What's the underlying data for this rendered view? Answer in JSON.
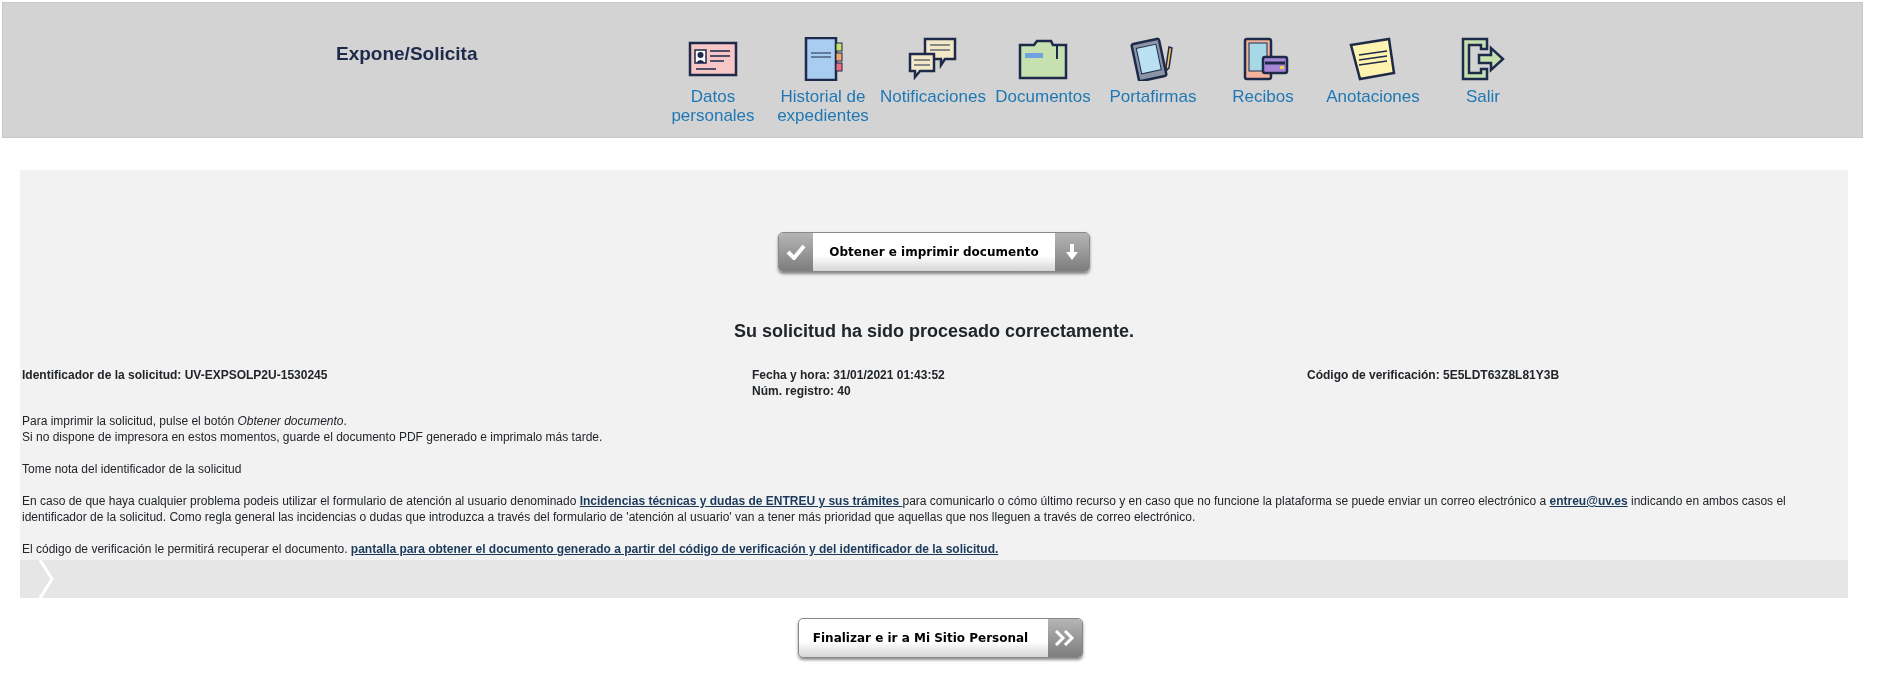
{
  "header": {
    "title": "Expone/Solicita",
    "nav": [
      {
        "label": "Datos personales"
      },
      {
        "label": "Historial de expedientes"
      },
      {
        "label": "Notificaciones"
      },
      {
        "label": "Documentos"
      },
      {
        "label": "Portafirmas"
      },
      {
        "label": "Recibos"
      },
      {
        "label": "Anotaciones"
      },
      {
        "label": "Salir"
      }
    ]
  },
  "main": {
    "print_button": "Obtener e imprimir documento",
    "heading": "Su solicitud ha sido procesado correctamente.",
    "info": [
      {
        "lines": [
          "Identificador de la solicitud: UV-EXPSOLP2U-1530245"
        ]
      },
      {
        "lines": [
          "Fecha y hora: 31/01/2021 01:43:52",
          "Núm. registro: 40"
        ]
      },
      {
        "lines": [
          "Código de verificación: 5E5LDT63Z8L81Y3B"
        ]
      }
    ],
    "paragraphs": [
      [
        [
          {
            "kind": "text",
            "text": "Para imprimir la solicitud, pulse el botón *Obtener documento*."
          }
        ],
        [
          {
            "kind": "text",
            "text": "Si no dispone de impresora en estos momentos, guarde el documento PDF generado e imprimalo más tarde."
          }
        ]
      ],
      [
        [
          {
            "kind": "text",
            "text": "Tome nota del identificador de la solicitud"
          }
        ]
      ],
      [
        [
          {
            "kind": "text",
            "text": "En caso de que haya cualquier problema podeis utilizar el formulario de atención al usuario denominado "
          },
          {
            "kind": "link",
            "text": "Incidencias técnicas y dudas de ENTREU y sus trámites "
          },
          {
            "kind": "text",
            "text": "para comunicarlo o cómo último recurso y en caso que no funcione la plataforma se puede enviar un correo electrónico a "
          },
          {
            "kind": "link",
            "text": "entreu@uv.es"
          },
          {
            "kind": "text",
            "text": " indicando en ambos casos el identificador de la solicitud. Como regla general las incidencias o dudas que introduzca a través del formulario de 'atención al usuario' van a tener más prioridad que aquellas que nos lleguen a través de correo electrónico."
          }
        ]
      ],
      [
        [
          {
            "kind": "text",
            "text": "El código de verificación le permitirá recuperar el documento. "
          },
          {
            "kind": "link",
            "text": "pantalla para obtener el documento generado a partir del código de verificación y del identificador de la solicitud."
          }
        ]
      ]
    ]
  },
  "finish_button": "Finalizar e ir a Mi Sitio Personal"
}
